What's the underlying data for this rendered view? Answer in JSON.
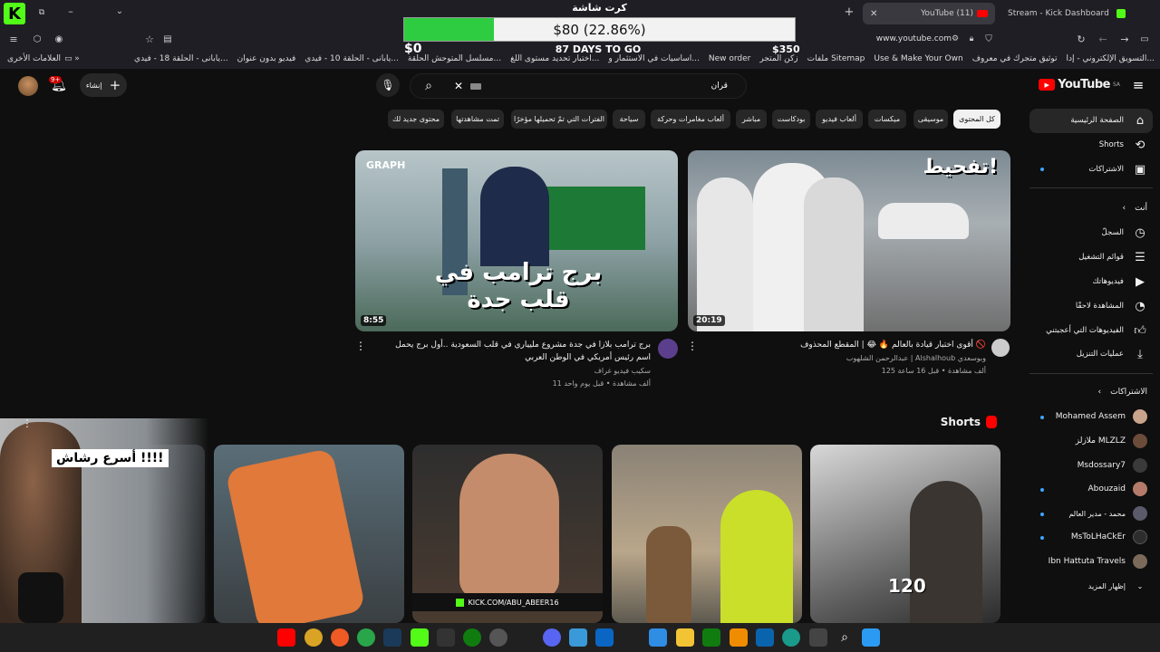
{
  "browser": {
    "tabs": [
      {
        "label": "YouTube (11)",
        "active": true
      },
      {
        "label": "Stream - Kick Dashboard",
        "active": false
      }
    ],
    "url": "www.youtube.com",
    "bookmarks": [
      "التسويق الإلكتروني - إدا...",
      "توثيق متجرك في معروف",
      "Use & Make Your Own",
      "ملفات Sitemap",
      "زكن المتجر",
      "New order",
      "أساسيات في الاستثمار و...",
      "اختبار تحديد مستوى اللغ...",
      "مسلسل المتوحش الحلقة...",
      "يابانى - الحلقة 10 - فيدي...",
      "فيديو بدون عنوان",
      "يابانى - الحلقة 18 - فيدي...",
      "العلامات الأخرى"
    ]
  },
  "overlay": {
    "title": "كرت شاشة",
    "goal_text": "$80 (22.86%)",
    "progress": 0.2286,
    "days_left": "87 DAYS TO GO",
    "min": "$0",
    "max": "$350"
  },
  "youtube": {
    "logo": "YouTube",
    "region": "SA",
    "search_value": "قرآن",
    "create_label": "إنشاء",
    "notif_count": "9+",
    "chips": [
      "كل المحتوى",
      "موسيقى",
      "ميكسات",
      "ألعاب فيديو",
      "بودكاست",
      "مباشر",
      "ألعاب مغامرات وحركة",
      "سياحة",
      "الفترات التي تمّ تحميلها مؤخرًا",
      "تمت مشاهدتها",
      "محتوى جديد لك"
    ],
    "sidebar_main": [
      {
        "label": "الصفحة الرئيسية",
        "icon": "home-icon"
      },
      {
        "label": "Shorts",
        "icon": "shorts-icon"
      },
      {
        "label": "الاشتراكات",
        "icon": "subscriptions-icon"
      }
    ],
    "you_header": "أنت",
    "sidebar_you": [
      {
        "label": "السجلّ",
        "icon": "history-icon"
      },
      {
        "label": "قوائم التشغيل",
        "icon": "playlists-icon"
      },
      {
        "label": "فيديوهاتك",
        "icon": "your-videos-icon"
      },
      {
        "label": "المشاهدة لاحقًا",
        "icon": "watch-later-icon"
      },
      {
        "label": "الفيديوهات التي أعجبتني",
        "icon": "liked-icon"
      },
      {
        "label": "عمليات التنزيل",
        "icon": "download-icon"
      }
    ],
    "subs_header": "الاشتراكات",
    "subscriptions": [
      {
        "name": "Mohamed Assem",
        "color": "#c9a38a",
        "new": true
      },
      {
        "name": "ملازلز MLZLZ",
        "color": "#6b4b3a",
        "new": false
      },
      {
        "name": "Msdossary7",
        "color": "#3a3a3a",
        "new": false
      },
      {
        "name": "Abouzaid",
        "color": "#b57a6a",
        "new": true
      },
      {
        "name": "محمد - مدير العالم",
        "color": "#5a5a6a",
        "new": true
      },
      {
        "name": "MsToLHaCkEr",
        "color": "#2d2d2d",
        "new": true
      },
      {
        "name": "Ibn Hattuta Travels",
        "color": "#7b6a5a",
        "new": false
      }
    ],
    "show_more": "إظهار المزيد",
    "videos": [
      {
        "title": "أقوى اختبار قيادة بالعالم 🔥 😂 | المقطع المحذوف 🚫",
        "channel": "عبدالرحمن الشلهوب | Alshalhoub وبوسعدي",
        "meta": "125 ألف مشاهدة • قبل 16 ساعة",
        "duration": "20:19",
        "overlay_text": "تفحيط!"
      },
      {
        "title": "برج ترامب بلازا في جدة مشروع مليياري في قلب السعودية ..أول برج يحمل اسم رئيس أمريكي في الوطن العربي",
        "channel": "سكيب فيديو غراف",
        "meta": "11 ألف مشاهدة • قبل يوم واحد",
        "duration": "8:55",
        "overlay_text": "برج ترامب في قلب جدة",
        "brand": "GRAPH"
      }
    ],
    "shorts_header": "Shorts",
    "shorts_overlay_num": "120",
    "kick_caption": "KICK.COM/ABU_ABEER16"
  },
  "webcam": {
    "caption": "أسرع رشاش !!!!"
  }
}
